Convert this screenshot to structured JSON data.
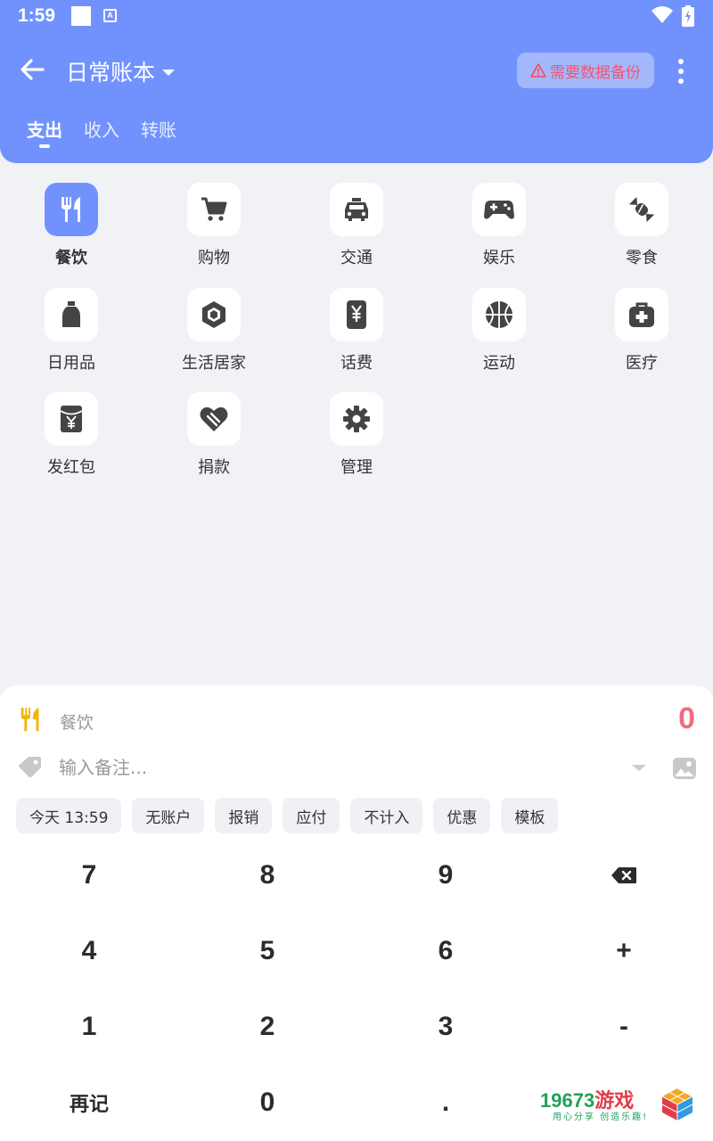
{
  "status": {
    "time": "1:59",
    "a_badge": "A"
  },
  "header": {
    "book_title": "日常账本",
    "backup_label": "需要数据备份",
    "tabs": [
      {
        "label": "支出",
        "active": true
      },
      {
        "label": "收入",
        "active": false
      },
      {
        "label": "转账",
        "active": false
      }
    ]
  },
  "categories": [
    {
      "label": "餐饮",
      "icon": "utensils-icon",
      "selected": true
    },
    {
      "label": "购物",
      "icon": "cart-icon"
    },
    {
      "label": "交通",
      "icon": "car-icon"
    },
    {
      "label": "娱乐",
      "icon": "gamepad-icon"
    },
    {
      "label": "零食",
      "icon": "candy-icon"
    },
    {
      "label": "日用品",
      "icon": "bottle-icon"
    },
    {
      "label": "生活居家",
      "icon": "cube-icon"
    },
    {
      "label": "话费",
      "icon": "phone-yen-icon"
    },
    {
      "label": "运动",
      "icon": "basketball-icon"
    },
    {
      "label": "医疗",
      "icon": "medkit-icon"
    },
    {
      "label": "发红包",
      "icon": "red-envelope-icon"
    },
    {
      "label": "捐款",
      "icon": "heart-hand-icon"
    },
    {
      "label": "管理",
      "icon": "gear-icon"
    }
  ],
  "entry": {
    "category_label": "餐饮",
    "amount": "0",
    "note_placeholder": "输入备注..."
  },
  "chips": [
    "今天 13:59",
    "无账户",
    "报销",
    "应付",
    "不计入",
    "优惠",
    "模板"
  ],
  "keypad": [
    [
      "7",
      "8",
      "9",
      "backspace"
    ],
    [
      "4",
      "5",
      "6",
      "+"
    ],
    [
      "1",
      "2",
      "3",
      "-"
    ],
    [
      "再记",
      "0",
      ".",
      ""
    ]
  ],
  "watermark": {
    "brand_num": "19673",
    "brand_cn": "游戏",
    "slogan": "用心分享 创造乐趣!"
  },
  "colors": {
    "accent": "#7192fd",
    "amount": "#ee6e81",
    "warning": "#f0566f",
    "food_icon": "#f5b400"
  }
}
